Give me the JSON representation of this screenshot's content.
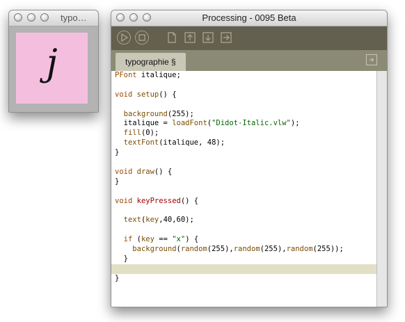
{
  "sketch_window": {
    "title": "typo…",
    "canvas_text": "j",
    "canvas_color": "#f4bfdf"
  },
  "editor_window": {
    "title": "Processing - 0095 Beta",
    "toolbar": {
      "buttons": [
        "play-icon",
        "stop-icon",
        "new-icon",
        "open-icon",
        "save-icon",
        "export-icon"
      ]
    },
    "tab": {
      "label": "typographie §"
    },
    "tab_menu_icon": "arrow-right-icon",
    "code_lines": [
      [
        [
          "t",
          "PFont"
        ],
        [
          "p",
          " italique;"
        ]
      ],
      [],
      [
        [
          "t",
          "void"
        ],
        [
          "p",
          " "
        ],
        [
          "f",
          "setup"
        ],
        [
          "p",
          "() {"
        ]
      ],
      [],
      [
        [
          "p",
          "  "
        ],
        [
          "f",
          "background"
        ],
        [
          "p",
          "(255);"
        ]
      ],
      [
        [
          "p",
          "  italique = "
        ],
        [
          "f",
          "loadFont"
        ],
        [
          "p",
          "("
        ],
        [
          "s",
          "\"Didot-Italic.vlw\""
        ],
        [
          "p",
          ");"
        ]
      ],
      [
        [
          "p",
          "  "
        ],
        [
          "f",
          "fill"
        ],
        [
          "p",
          "(0);"
        ]
      ],
      [
        [
          "p",
          "  "
        ],
        [
          "f",
          "textFont"
        ],
        [
          "p",
          "(italique, 48);"
        ]
      ],
      [
        [
          "p",
          "}"
        ]
      ],
      [],
      [
        [
          "t",
          "void"
        ],
        [
          "p",
          " "
        ],
        [
          "f",
          "draw"
        ],
        [
          "p",
          "() {"
        ]
      ],
      [
        [
          "p",
          "}"
        ]
      ],
      [],
      [
        [
          "t",
          "void"
        ],
        [
          "p",
          " "
        ],
        [
          "e",
          "keyPressed"
        ],
        [
          "p",
          "() {"
        ]
      ],
      [],
      [
        [
          "p",
          "  "
        ],
        [
          "f",
          "text"
        ],
        [
          "p",
          "("
        ],
        [
          "f",
          "key"
        ],
        [
          "p",
          ",40,60);"
        ]
      ],
      [],
      [
        [
          "p",
          "  "
        ],
        [
          "k",
          "if"
        ],
        [
          "p",
          " ("
        ],
        [
          "f",
          "key"
        ],
        [
          "p",
          " == "
        ],
        [
          "s",
          "\"x\""
        ],
        [
          "p",
          ") {"
        ]
      ],
      [
        [
          "p",
          "    "
        ],
        [
          "f",
          "background"
        ],
        [
          "p",
          "("
        ],
        [
          "f",
          "random"
        ],
        [
          "p",
          "(255),"
        ],
        [
          "f",
          "random"
        ],
        [
          "p",
          "(255),"
        ],
        [
          "f",
          "random"
        ],
        [
          "p",
          "(255));"
        ]
      ],
      [
        [
          "p",
          "  }"
        ]
      ],
      [],
      [
        [
          "p",
          "}"
        ]
      ]
    ],
    "highlight_line": 20,
    "colors": {
      "toolbar": "#63604f",
      "tabbar": "#8b8a74",
      "tab": "#c9c7b6",
      "current_line": "#e2e0c4"
    }
  }
}
